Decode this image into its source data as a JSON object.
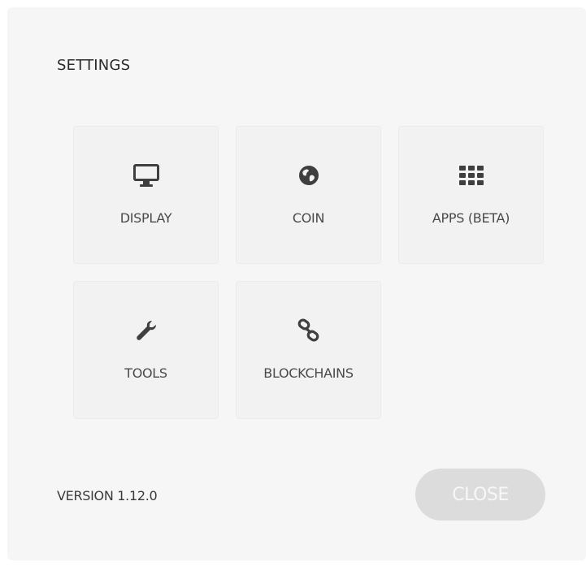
{
  "dialog": {
    "title": "SETTINGS",
    "tiles": [
      {
        "label": "DISPLAY",
        "icon": "monitor-icon"
      },
      {
        "label": "COIN",
        "icon": "globe-icon"
      },
      {
        "label": "APPS (BETA)",
        "icon": "grid-icon"
      },
      {
        "label": "TOOLS",
        "icon": "wrench-icon"
      },
      {
        "label": "BLOCKCHAINS",
        "icon": "chain-link-icon"
      }
    ],
    "version": "VERSION 1.12.0",
    "close_label": "CLOSE"
  }
}
